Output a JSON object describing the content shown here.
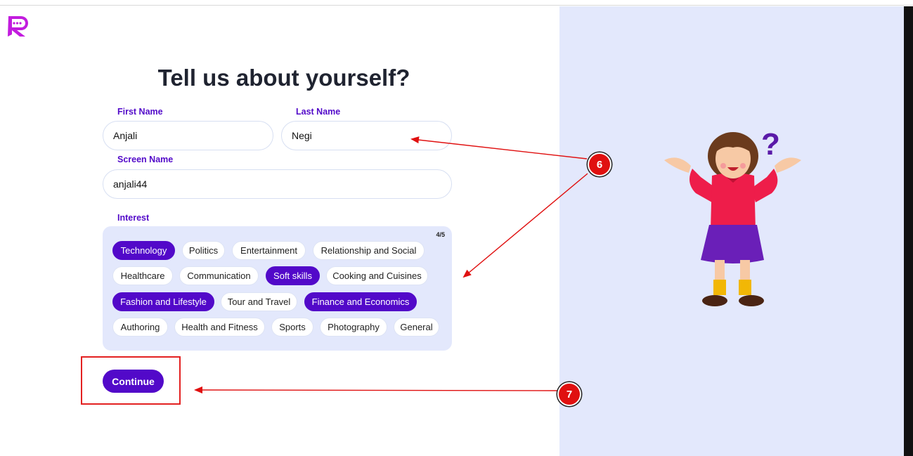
{
  "page": {
    "title": "Tell us about yourself?"
  },
  "form": {
    "first_name_label": "First Name",
    "first_name_value": "Anjali",
    "last_name_label": "Last Name",
    "last_name_value": "Negi",
    "screen_name_label": "Screen Name",
    "screen_name_value": "anjali44",
    "interest_label": "Interest",
    "interest_count": "4/5",
    "interests": [
      {
        "label": "Technology",
        "selected": true
      },
      {
        "label": "Politics",
        "selected": false
      },
      {
        "label": "Entertainment",
        "selected": false
      },
      {
        "label": "Relationship and Social",
        "selected": false
      },
      {
        "label": "Healthcare",
        "selected": false
      },
      {
        "label": "Communication",
        "selected": false
      },
      {
        "label": "Soft skills",
        "selected": true
      },
      {
        "label": "Cooking and Cuisines",
        "selected": false
      },
      {
        "label": "Fashion and Lifestyle",
        "selected": true
      },
      {
        "label": "Tour and Travel",
        "selected": false
      },
      {
        "label": "Finance and Economics",
        "selected": true
      },
      {
        "label": "Authoring",
        "selected": false
      },
      {
        "label": "Health and Fitness",
        "selected": false
      },
      {
        "label": "Sports",
        "selected": false
      },
      {
        "label": "Photography",
        "selected": false
      },
      {
        "label": "General",
        "selected": false
      }
    ],
    "continue_label": "Continue"
  },
  "annotations": {
    "badge_6": "6",
    "badge_7": "7"
  },
  "colors": {
    "brand": "#5209c9",
    "panel": "#e3e8fc",
    "annotation": "#e01010"
  },
  "icons": {
    "logo": "chat-bubble-r-logo-icon",
    "illustration": "confused-girl-illustration"
  }
}
